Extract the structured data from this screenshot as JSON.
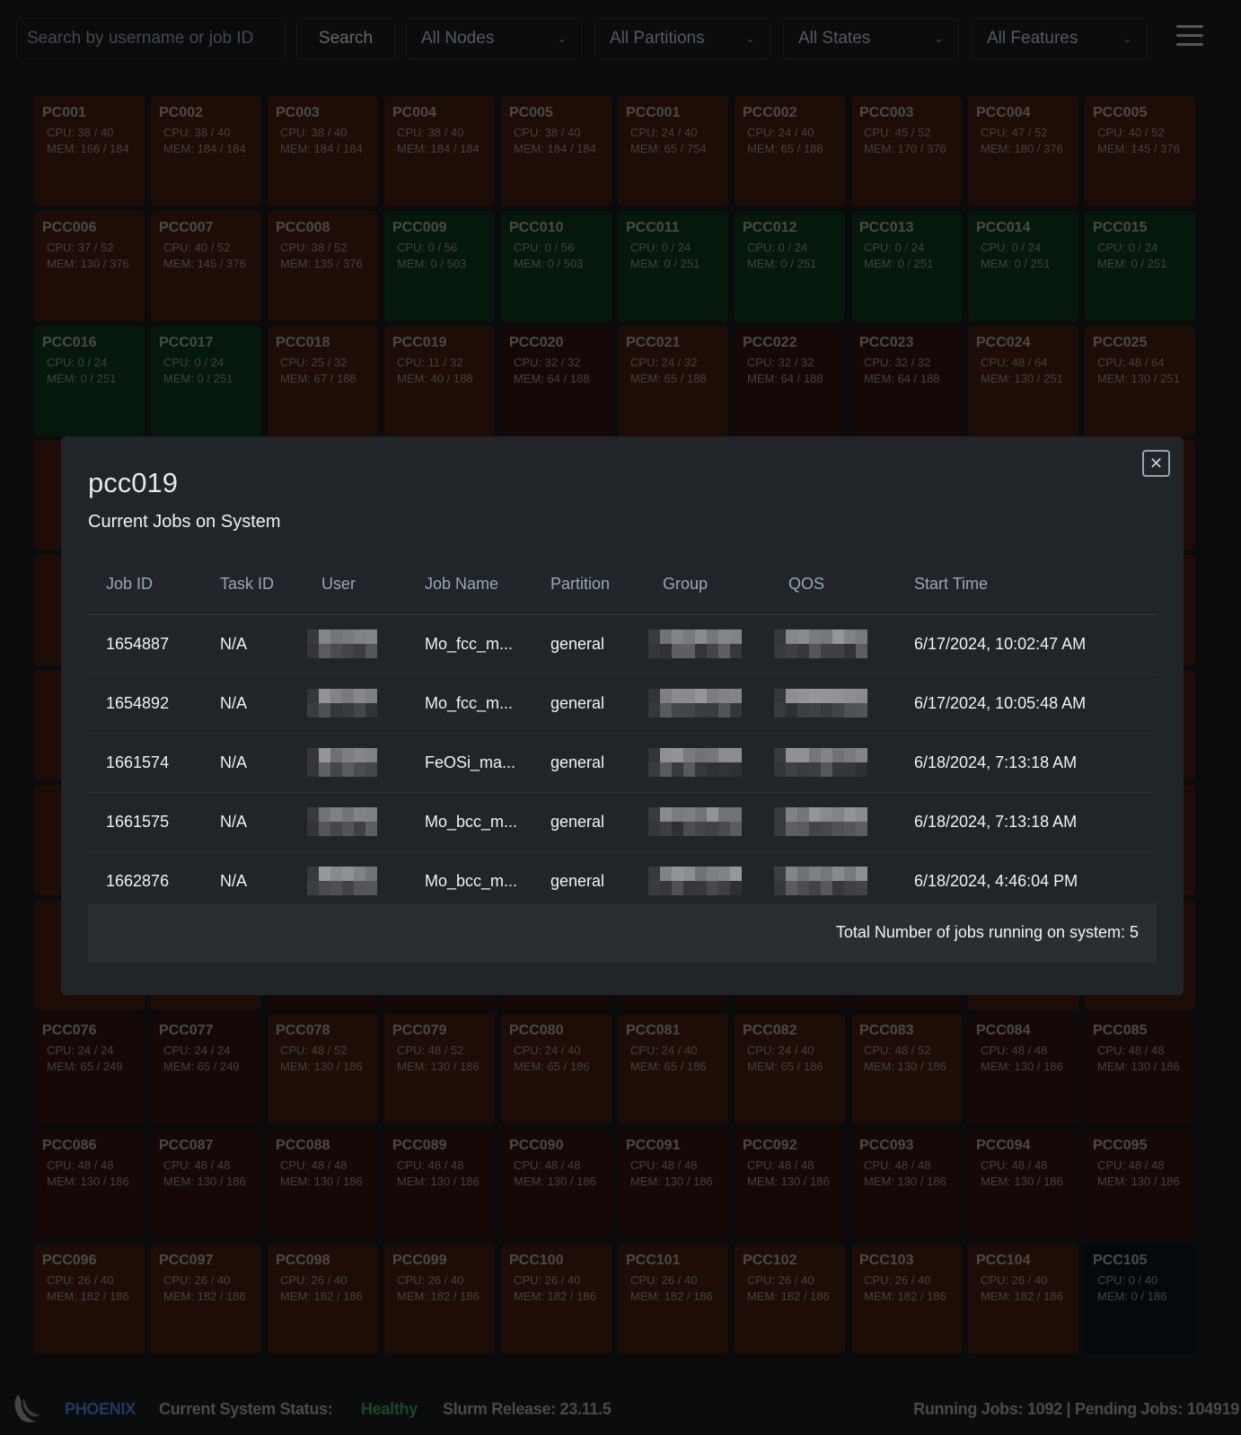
{
  "toolbar": {
    "search_placeholder": "Search by username or job ID",
    "search_label": "Search",
    "filters": [
      "All Nodes",
      "All Partitions",
      "All States",
      "All Features"
    ],
    "menu_icon": "hamburger-icon"
  },
  "colors": {
    "orange": "#3c1a0c",
    "red": "#2e0f0e",
    "green": "#0c2e16",
    "dark": "#0b1218",
    "brand": "#2a4f80",
    "healthy": "#1f6b32"
  },
  "nodes": [
    {
      "name": "PC001",
      "cpu": "CPU: 38 / 40",
      "mem": "MEM: 166 / 184",
      "color": "orange"
    },
    {
      "name": "PC002",
      "cpu": "CPU: 38 / 40",
      "mem": "MEM: 184 / 184",
      "color": "orange"
    },
    {
      "name": "PC003",
      "cpu": "CPU: 38 / 40",
      "mem": "MEM: 184 / 184",
      "color": "orange"
    },
    {
      "name": "PC004",
      "cpu": "CPU: 38 / 40",
      "mem": "MEM: 184 / 184",
      "color": "orange"
    },
    {
      "name": "PC005",
      "cpu": "CPU: 38 / 40",
      "mem": "MEM: 184 / 184",
      "color": "orange"
    },
    {
      "name": "PCC001",
      "cpu": "CPU: 24 / 40",
      "mem": "MEM: 65 / 754",
      "color": "orange"
    },
    {
      "name": "PCC002",
      "cpu": "CPU: 24 / 40",
      "mem": "MEM: 65 / 188",
      "color": "orange"
    },
    {
      "name": "PCC003",
      "cpu": "CPU: 45 / 52",
      "mem": "MEM: 170 / 376",
      "color": "orange"
    },
    {
      "name": "PCC004",
      "cpu": "CPU: 47 / 52",
      "mem": "MEM: 180 / 376",
      "color": "orange"
    },
    {
      "name": "PCC005",
      "cpu": "CPU: 40 / 52",
      "mem": "MEM: 145 / 376",
      "color": "orange"
    },
    {
      "name": "PCC006",
      "cpu": "CPU: 37 / 52",
      "mem": "MEM: 130 / 376",
      "color": "orange"
    },
    {
      "name": "PCC007",
      "cpu": "CPU: 40 / 52",
      "mem": "MEM: 145 / 376",
      "color": "orange"
    },
    {
      "name": "PCC008",
      "cpu": "CPU: 38 / 52",
      "mem": "MEM: 135 / 376",
      "color": "orange"
    },
    {
      "name": "PCC009",
      "cpu": "CPU: 0 / 56",
      "mem": "MEM: 0 / 503",
      "color": "green"
    },
    {
      "name": "PCC010",
      "cpu": "CPU: 0 / 56",
      "mem": "MEM: 0 / 503",
      "color": "green"
    },
    {
      "name": "PCC011",
      "cpu": "CPU: 0 / 24",
      "mem": "MEM: 0 / 251",
      "color": "green"
    },
    {
      "name": "PCC012",
      "cpu": "CPU: 0 / 24",
      "mem": "MEM: 0 / 251",
      "color": "green"
    },
    {
      "name": "PCC013",
      "cpu": "CPU: 0 / 24",
      "mem": "MEM: 0 / 251",
      "color": "green"
    },
    {
      "name": "PCC014",
      "cpu": "CPU: 0 / 24",
      "mem": "MEM: 0 / 251",
      "color": "green"
    },
    {
      "name": "PCC015",
      "cpu": "CPU: 0 / 24",
      "mem": "MEM: 0 / 251",
      "color": "green"
    },
    {
      "name": "PCC016",
      "cpu": "CPU: 0 / 24",
      "mem": "MEM: 0 / 251",
      "color": "green"
    },
    {
      "name": "PCC017",
      "cpu": "CPU: 0 / 24",
      "mem": "MEM: 0 / 251",
      "color": "green"
    },
    {
      "name": "PCC018",
      "cpu": "CPU: 25 / 32",
      "mem": "MEM: 67 / 188",
      "color": "orange"
    },
    {
      "name": "PCC019",
      "cpu": "CPU: 11 / 32",
      "mem": "MEM: 40 / 188",
      "color": "orange"
    },
    {
      "name": "PCC020",
      "cpu": "CPU: 32 / 32",
      "mem": "MEM: 64 / 188",
      "color": "red"
    },
    {
      "name": "PCC021",
      "cpu": "CPU: 24 / 32",
      "mem": "MEM: 65 / 188",
      "color": "orange"
    },
    {
      "name": "PCC022",
      "cpu": "CPU: 32 / 32",
      "mem": "MEM: 64 / 188",
      "color": "red"
    },
    {
      "name": "PCC023",
      "cpu": "CPU: 32 / 32",
      "mem": "MEM: 64 / 188",
      "color": "red"
    },
    {
      "name": "PCC024",
      "cpu": "CPU: 48 / 64",
      "mem": "MEM: 130 / 251",
      "color": "orange"
    },
    {
      "name": "PCC025",
      "cpu": "CPU: 48 / 64",
      "mem": "MEM: 130 / 251",
      "color": "orange"
    }
  ],
  "nodes_bottom": [
    {
      "name": "PCC076",
      "cpu": "CPU: 24 / 24",
      "mem": "MEM: 65 / 249",
      "color": "red"
    },
    {
      "name": "PCC077",
      "cpu": "CPU: 24 / 24",
      "mem": "MEM: 65 / 249",
      "color": "red"
    },
    {
      "name": "PCC078",
      "cpu": "CPU: 48 / 52",
      "mem": "MEM: 130 / 186",
      "color": "orange"
    },
    {
      "name": "PCC079",
      "cpu": "CPU: 48 / 52",
      "mem": "MEM: 130 / 186",
      "color": "orange"
    },
    {
      "name": "PCC080",
      "cpu": "CPU: 24 / 40",
      "mem": "MEM: 65 / 186",
      "color": "orange"
    },
    {
      "name": "PCC081",
      "cpu": "CPU: 24 / 40",
      "mem": "MEM: 65 / 186",
      "color": "orange"
    },
    {
      "name": "PCC082",
      "cpu": "CPU: 24 / 40",
      "mem": "MEM: 65 / 186",
      "color": "orange"
    },
    {
      "name": "PCC083",
      "cpu": "CPU: 48 / 52",
      "mem": "MEM: 130 / 186",
      "color": "orange"
    },
    {
      "name": "PCC084",
      "cpu": "CPU: 48 / 48",
      "mem": "MEM: 130 / 186",
      "color": "red"
    },
    {
      "name": "PCC085",
      "cpu": "CPU: 48 / 48",
      "mem": "MEM: 130 / 186",
      "color": "red"
    },
    {
      "name": "PCC086",
      "cpu": "CPU: 48 / 48",
      "mem": "MEM: 130 / 186",
      "color": "red"
    },
    {
      "name": "PCC087",
      "cpu": "CPU: 48 / 48",
      "mem": "MEM: 130 / 186",
      "color": "red"
    },
    {
      "name": "PCC088",
      "cpu": "CPU: 48 / 48",
      "mem": "MEM: 130 / 186",
      "color": "red"
    },
    {
      "name": "PCC089",
      "cpu": "CPU: 48 / 48",
      "mem": "MEM: 130 / 186",
      "color": "red"
    },
    {
      "name": "PCC090",
      "cpu": "CPU: 48 / 48",
      "mem": "MEM: 130 / 186",
      "color": "red"
    },
    {
      "name": "PCC091",
      "cpu": "CPU: 48 / 48",
      "mem": "MEM: 130 / 186",
      "color": "red"
    },
    {
      "name": "PCC092",
      "cpu": "CPU: 48 / 48",
      "mem": "MEM: 130 / 186",
      "color": "red"
    },
    {
      "name": "PCC093",
      "cpu": "CPU: 48 / 48",
      "mem": "MEM: 130 / 186",
      "color": "red"
    },
    {
      "name": "PCC094",
      "cpu": "CPU: 48 / 48",
      "mem": "MEM: 130 / 186",
      "color": "red"
    },
    {
      "name": "PCC095",
      "cpu": "CPU: 48 / 48",
      "mem": "MEM: 130 / 186",
      "color": "red"
    },
    {
      "name": "PCC096",
      "cpu": "CPU: 26 / 40",
      "mem": "MEM: 182 / 186",
      "color": "orange"
    },
    {
      "name": "PCC097",
      "cpu": "CPU: 26 / 40",
      "mem": "MEM: 182 / 186",
      "color": "orange"
    },
    {
      "name": "PCC098",
      "cpu": "CPU: 26 / 40",
      "mem": "MEM: 182 / 186",
      "color": "orange"
    },
    {
      "name": "PCC099",
      "cpu": "CPU: 26 / 40",
      "mem": "MEM: 182 / 186",
      "color": "orange"
    },
    {
      "name": "PCC100",
      "cpu": "CPU: 26 / 40",
      "mem": "MEM: 182 / 186",
      "color": "orange"
    },
    {
      "name": "PCC101",
      "cpu": "CPU: 26 / 40",
      "mem": "MEM: 182 / 186",
      "color": "orange"
    },
    {
      "name": "PCC102",
      "cpu": "CPU: 26 / 40",
      "mem": "MEM: 182 / 186",
      "color": "orange"
    },
    {
      "name": "PCC103",
      "cpu": "CPU: 26 / 40",
      "mem": "MEM: 182 / 186",
      "color": "orange"
    },
    {
      "name": "PCC104",
      "cpu": "CPU: 26 / 40",
      "mem": "MEM: 182 / 186",
      "color": "orange"
    },
    {
      "name": "PCC105",
      "cpu": "CPU: 0 / 40",
      "mem": "MEM: 0 / 186",
      "color": "dark"
    }
  ],
  "footer": {
    "brand": "PHOENIX",
    "status_label": "Current System Status:",
    "status_value": "Healthy",
    "slurm": "Slurm Release: 23.11.5",
    "jobs": "Running Jobs: 1092 | Pending Jobs: 104919"
  },
  "modal": {
    "title": "pcc019",
    "subtitle": "Current Jobs on System",
    "close_icon": "close-icon",
    "columns": [
      "Job ID",
      "Task ID",
      "User",
      "Job Name",
      "Partition",
      "Group",
      "QOS",
      "Start Time"
    ],
    "rows": [
      {
        "job_id": "1654887",
        "task_id": "N/A",
        "job_name": "Mo_fcc_m...",
        "partition": "general",
        "start": "6/17/2024, 10:02:47 AM"
      },
      {
        "job_id": "1654892",
        "task_id": "N/A",
        "job_name": "Mo_fcc_m...",
        "partition": "general",
        "start": "6/17/2024, 10:05:48 AM"
      },
      {
        "job_id": "1661574",
        "task_id": "N/A",
        "job_name": "FeOSi_ma...",
        "partition": "general",
        "start": "6/18/2024, 7:13:18 AM"
      },
      {
        "job_id": "1661575",
        "task_id": "N/A",
        "job_name": "Mo_bcc_m...",
        "partition": "general",
        "start": "6/18/2024, 7:13:18 AM"
      },
      {
        "job_id": "1662876",
        "task_id": "N/A",
        "job_name": "Mo_bcc_m...",
        "partition": "general",
        "start": "6/18/2024, 4:46:04 PM"
      }
    ],
    "redacted_columns": [
      "User",
      "Group",
      "QOS"
    ],
    "total": "Total Number of jobs running on system: 5"
  }
}
